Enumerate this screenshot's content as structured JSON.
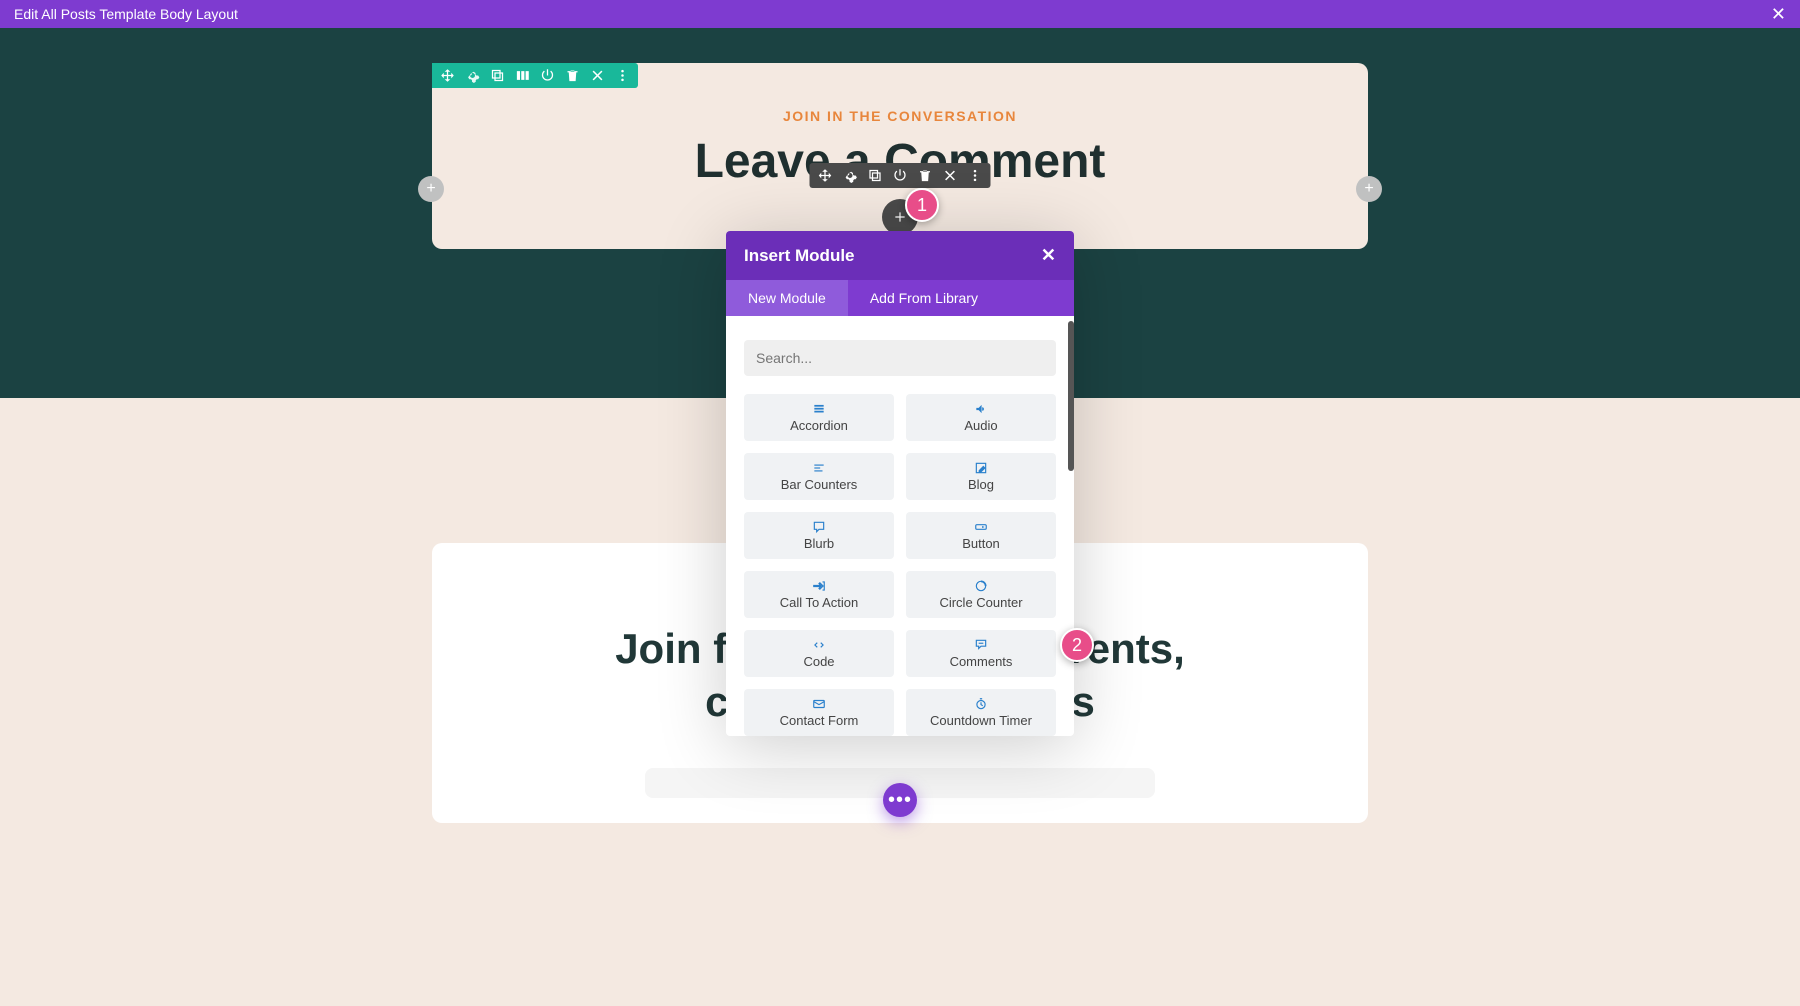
{
  "topbar": {
    "title": "Edit All Posts Template Body Layout",
    "close": "✕"
  },
  "card": {
    "subtitle": "JOIN IN THE CONVERSATION",
    "title": "Leave a Comment"
  },
  "addHandle": "+",
  "annotations": {
    "one": "1",
    "two": "2"
  },
  "modal": {
    "title": "Insert Module",
    "close": "✕",
    "tabs": {
      "new": "New Module",
      "library": "Add From Library"
    },
    "searchPlaceholder": "Search...",
    "modules": [
      {
        "label": "Accordion",
        "icon": "accordion"
      },
      {
        "label": "Audio",
        "icon": "audio"
      },
      {
        "label": "Bar Counters",
        "icon": "bar"
      },
      {
        "label": "Blog",
        "icon": "blog"
      },
      {
        "label": "Blurb",
        "icon": "blurb"
      },
      {
        "label": "Button",
        "icon": "button"
      },
      {
        "label": "Call To Action",
        "icon": "cta"
      },
      {
        "label": "Circle Counter",
        "icon": "circle"
      },
      {
        "label": "Code",
        "icon": "code"
      },
      {
        "label": "Comments",
        "icon": "comments"
      },
      {
        "label": "Contact Form",
        "icon": "form"
      },
      {
        "label": "Countdown Timer",
        "icon": "timer"
      }
    ]
  },
  "bottom": {
    "title": "Join for free recipes, events, conversation & tips"
  },
  "fab": "•••"
}
